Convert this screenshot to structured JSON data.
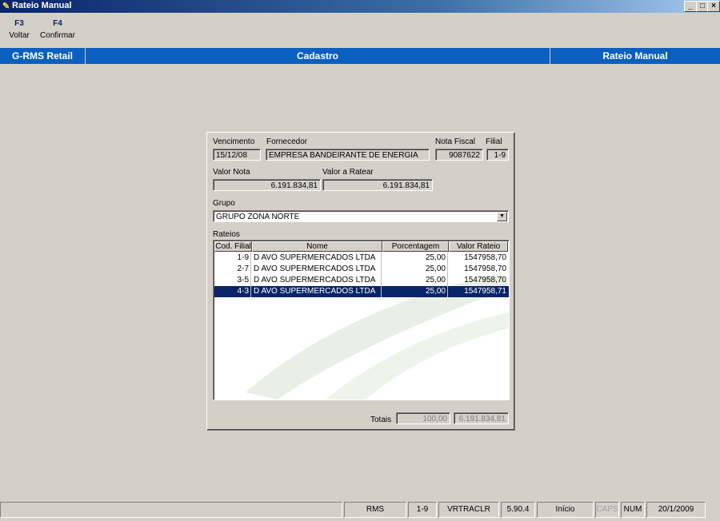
{
  "window": {
    "title": "Rateio Manual",
    "minimize": "_",
    "maximize": "□",
    "close": "×"
  },
  "toolbar": [
    {
      "key": "F3",
      "label": "Voltar"
    },
    {
      "key": "F4",
      "label": "Confirmar"
    }
  ],
  "header": {
    "app": "G-RMS Retail",
    "section": "Cadastro",
    "screen": "Rateio Manual"
  },
  "form": {
    "vencimento_label": "Vencimento",
    "vencimento": "15/12/08",
    "fornecedor_label": "Fornecedor",
    "fornecedor": "EMPRESA BANDEIRANTE DE ENERGIA",
    "nota_fiscal_label": "Nota Fiscal",
    "nota_fiscal": "9087622",
    "filial_label": "Filial",
    "filial": "1-9",
    "valor_nota_label": "Valor Nota",
    "valor_nota": "6.191.834,81",
    "valor_ratear_label": "Valor a Ratear",
    "valor_ratear": "6.191.834,81",
    "grupo_label": "Grupo",
    "grupo": "GRUPO ZONA NORTE",
    "rateios_label": "Rateios"
  },
  "grid": {
    "columns": [
      "Cod. Filial",
      "Nome",
      "Porcentagem",
      "Valor Rateio"
    ],
    "rows": [
      {
        "filial": "1-9",
        "nome": "D AVO SUPERMERCADOS LTDA",
        "pct": "25,00",
        "valor": "1547958,70"
      },
      {
        "filial": "2-7",
        "nome": "D AVO SUPERMERCADOS LTDA",
        "pct": "25,00",
        "valor": "1547958,70"
      },
      {
        "filial": "3-5",
        "nome": "D AVO SUPERMERCADOS LTDA",
        "pct": "25,00",
        "valor": "1547958,70"
      },
      {
        "filial": "4-3",
        "nome": "D AVO SUPERMERCADOS LTDA",
        "pct": "25,00",
        "valor": "1547958,71"
      }
    ],
    "selected_row": 3
  },
  "totais": {
    "label": "Totais",
    "porcentagem": "100,00",
    "valor": "6.191.834,81"
  },
  "statusbar": {
    "system": "RMS",
    "filial": "1-9",
    "program": "VRTRACLR",
    "version": "5.90.4",
    "mode": "Início",
    "caps": "CAPS",
    "num": "NUM",
    "date": "20/1/2009"
  },
  "colors": {
    "title_bar": "#0a246a",
    "header_band": "#0a5fbf",
    "selection": "#0a246a",
    "background": "#d4d0c8"
  }
}
